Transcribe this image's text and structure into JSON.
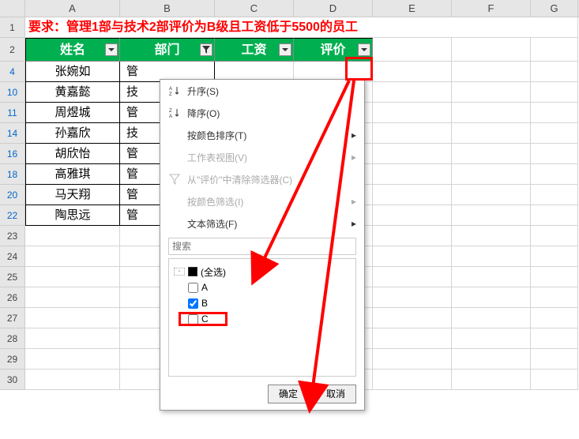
{
  "columns": [
    "A",
    "B",
    "C",
    "D",
    "E",
    "F",
    "G"
  ],
  "row1": {
    "requirement": "要求：管理1部与技术2部评价为B级且工资低于5500的员工"
  },
  "headers": {
    "name": "姓名",
    "dept": "部门",
    "salary": "工资",
    "rating": "评价"
  },
  "visible_row_numbers": [
    "1",
    "2",
    "4",
    "10",
    "11",
    "14",
    "16",
    "18",
    "20",
    "22",
    "23",
    "24",
    "25",
    "26",
    "27",
    "28",
    "29",
    "30"
  ],
  "data_rows": [
    {
      "name": "张婉如",
      "dept": "管"
    },
    {
      "name": "黄嘉懿",
      "dept": "技"
    },
    {
      "name": "周煜城",
      "dept": "管"
    },
    {
      "name": "孙嘉欣",
      "dept": "技"
    },
    {
      "name": "胡欣怡",
      "dept": "管"
    },
    {
      "name": "高雅琪",
      "dept": "管"
    },
    {
      "name": "马天翔",
      "dept": "管"
    },
    {
      "name": "陶思远",
      "dept": "管"
    }
  ],
  "filter_menu": {
    "sort_asc": "升序(S)",
    "sort_desc": "降序(O)",
    "sort_by_color": "按颜色排序(T)",
    "sheet_view": "工作表视图(V)",
    "clear_filter": "从\"评价\"中清除筛选器(C)",
    "filter_by_color": "按颜色筛选(I)",
    "text_filter": "文本筛选(F)",
    "search_placeholder": "搜索",
    "options": {
      "select_all": "(全选)",
      "a": "A",
      "b": "B",
      "c": "C"
    },
    "ok": "确定",
    "cancel": "取消"
  }
}
